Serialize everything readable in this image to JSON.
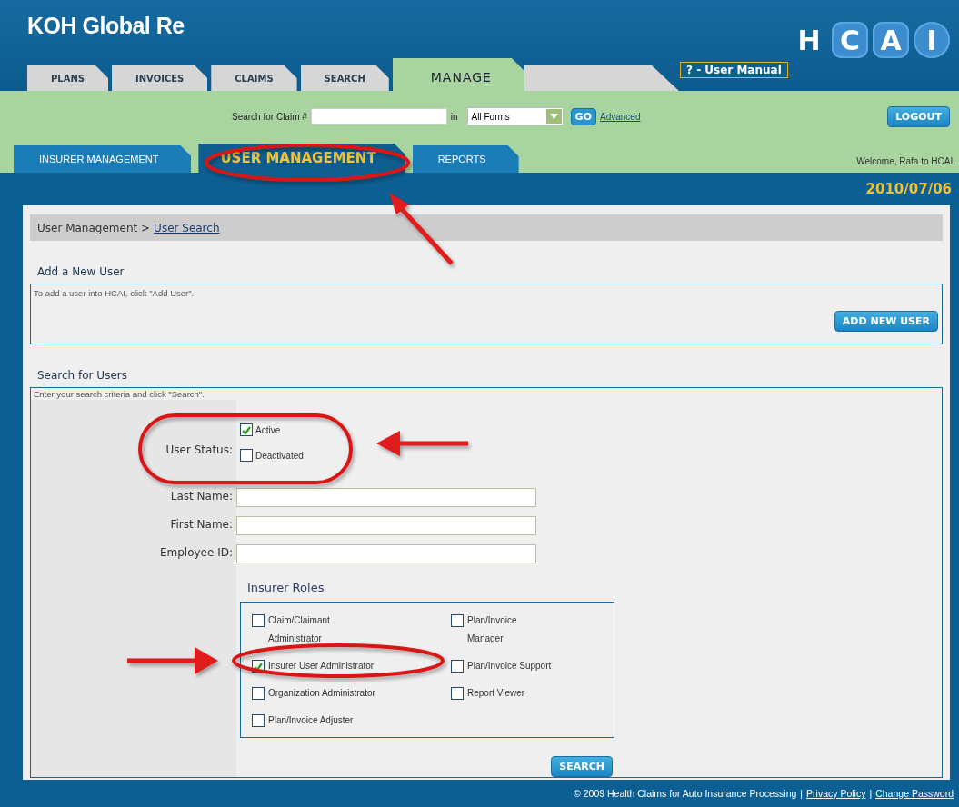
{
  "header": {
    "title": "KOH Global Re",
    "manual_link": "? - User Manual",
    "logo_letters": [
      {
        "letter": "H",
        "kind": "plain"
      },
      {
        "letter": "C",
        "kind": "square"
      },
      {
        "letter": "A",
        "kind": "square"
      },
      {
        "letter": "I",
        "kind": "circle"
      }
    ]
  },
  "tabs": [
    {
      "label": "PLANS",
      "selected": false
    },
    {
      "label": "INVOICES",
      "selected": false
    },
    {
      "label": "CLAIMS",
      "selected": false
    },
    {
      "label": "SEARCH",
      "selected": false
    },
    {
      "label": "MANAGE",
      "selected": true
    }
  ],
  "search_bar": {
    "label": "Search for Claim #",
    "in_label": "in",
    "form_select": "All Forms",
    "go": "GO",
    "advanced": "Advanced",
    "logout": "LOGOUT"
  },
  "subtabs": [
    {
      "label": "INSURER MANAGEMENT",
      "selected": false
    },
    {
      "label": "USER MANAGEMENT",
      "selected": true
    },
    {
      "label": "REPORTS",
      "selected": false
    }
  ],
  "welcome": "Welcome, Rafa to HCAI.",
  "date": "2010/07/06",
  "breadcrumb": {
    "parent": "User Management >",
    "current": "User Search"
  },
  "add_user": {
    "heading": "Add a New User",
    "text": "To add a user into HCAI, click \"Add User\".",
    "button": "ADD NEW USER"
  },
  "search_users": {
    "heading": "Search for Users",
    "text": "Enter your search criteria and click \"Search\".",
    "status_label": "User Status:",
    "statuses": [
      {
        "label": "Active",
        "checked": true
      },
      {
        "label": "Deactivated",
        "checked": false
      }
    ],
    "fields": [
      {
        "label": "Last Name:"
      },
      {
        "label": "First Name:"
      },
      {
        "label": "Employee ID:"
      }
    ],
    "roles_heading": "Insurer Roles",
    "roles_columns": [
      [
        {
          "label": "Claim/Claimant Administrator",
          "checked": false
        },
        {
          "label": "Insurer User Administrator",
          "checked": true
        },
        {
          "label": "Organization Administrator",
          "checked": false
        },
        {
          "label": "Plan/Invoice Adjuster",
          "checked": false
        }
      ],
      [
        {
          "label": "Plan/Invoice Manager",
          "checked": false
        },
        {
          "label": "Plan/Invoice Support",
          "checked": false
        },
        {
          "label": "Report Viewer",
          "checked": false
        }
      ]
    ],
    "button": "SEARCH"
  },
  "footer": [
    {
      "kind": "text",
      "text": "© 2009 Health Claims for Auto Insurance Processing"
    },
    {
      "kind": "separator",
      "text": "|"
    },
    {
      "kind": "link",
      "text": "Privacy Policy"
    },
    {
      "kind": "separator",
      "text": "|"
    },
    {
      "kind": "link",
      "text": "Change Password"
    }
  ]
}
